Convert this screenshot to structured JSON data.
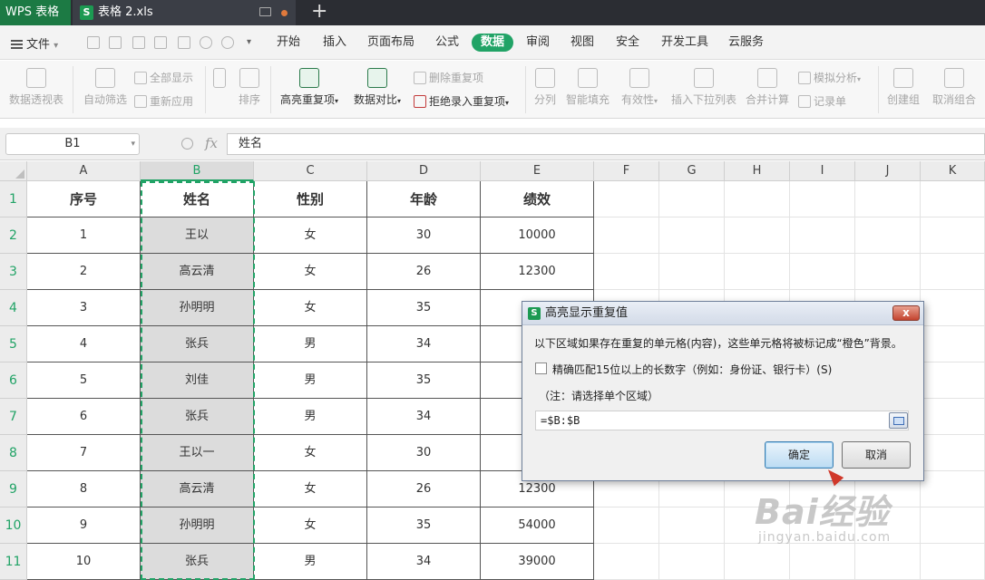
{
  "titlebar": {
    "app_name": "WPS 表格",
    "doc_tab": "表格 2.xls",
    "sheet_icon": "S"
  },
  "menubar": {
    "file_label": "文件",
    "tabs": [
      "开始",
      "插入",
      "页面布局",
      "公式",
      "数据",
      "审阅",
      "视图",
      "安全",
      "开发工具",
      "云服务"
    ],
    "active_tab": "数据"
  },
  "ribbon": {
    "pivot": "数据透视表",
    "autofilter": "自动筛选",
    "show_all": "全部显示",
    "reapply": "重新应用",
    "sort_az": "A↓Z",
    "sort": "排序",
    "highlight_dup": "高亮重复项",
    "data_compare": "数据对比",
    "remove_dup": "删除重复项",
    "reject_dup": "拒绝录入重复项",
    "split": "分列",
    "smart_fill": "智能填充",
    "validity": "有效性",
    "insert_dropdown": "插入下拉列表",
    "merge_calc": "合并计算",
    "simulate": "模拟分析",
    "record_sheet": "记录单",
    "create_group": "创建组",
    "ungroup": "取消组合"
  },
  "formula_bar": {
    "name_box": "B1",
    "fx": "fx",
    "value": "姓名"
  },
  "grid": {
    "columns": [
      "A",
      "B",
      "C",
      "D",
      "E",
      "F",
      "G",
      "H",
      "I",
      "J",
      "K"
    ],
    "rows": [
      "1",
      "2",
      "3",
      "4",
      "5",
      "6",
      "7",
      "8",
      "9",
      "10",
      "11"
    ],
    "header": [
      "序号",
      "姓名",
      "性别",
      "年龄",
      "绩效"
    ],
    "data": [
      [
        "1",
        "王以",
        "女",
        "30",
        "10000"
      ],
      [
        "2",
        "高云清",
        "女",
        "26",
        "12300"
      ],
      [
        "3",
        "孙明明",
        "女",
        "35",
        ""
      ],
      [
        "4",
        "张兵",
        "男",
        "34",
        ""
      ],
      [
        "5",
        "刘佳",
        "男",
        "35",
        ""
      ],
      [
        "6",
        "张兵",
        "男",
        "34",
        ""
      ],
      [
        "7",
        "王以一",
        "女",
        "30",
        ""
      ],
      [
        "8",
        "高云清",
        "女",
        "26",
        "12300"
      ],
      [
        "9",
        "孙明明",
        "女",
        "35",
        "54000"
      ],
      [
        "10",
        "张兵",
        "男",
        "34",
        "39000"
      ]
    ]
  },
  "dialog": {
    "title": "高亮显示重复值",
    "message": "以下区域如果存在重复的单元格(内容)，这些单元格将被标记成“橙色”背景。",
    "checkbox_label": "精确匹配15位以上的长数字（例如：身份证、银行卡）(S)",
    "checkbox_checked": false,
    "note": "（注：请选择单个区域）",
    "range_value": "=$B:$B",
    "ok_label": "确定",
    "cancel_label": "取消",
    "close_label": "x"
  },
  "watermark": {
    "logo": "Bai经验",
    "sub": "jingyan.baidu.com"
  },
  "colors": {
    "accent": "#21a366",
    "title_bg": "#2b2d33",
    "selection_fill": "#dcdcdc"
  }
}
